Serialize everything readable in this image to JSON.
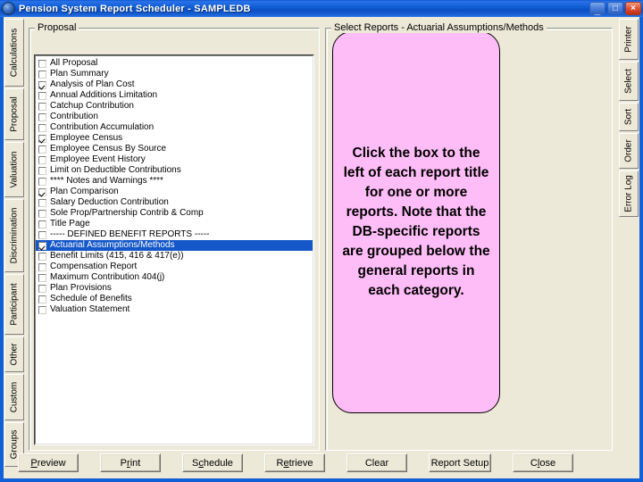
{
  "window": {
    "title": "Pension System Report Scheduler - SAMPLEDB",
    "app_icon": "globe-icon",
    "minimize_label": "_",
    "maximize_label": "□",
    "close_label": "×"
  },
  "left_tabs": [
    {
      "label": "Calculations"
    },
    {
      "label": "Proposal"
    },
    {
      "label": "Valuation"
    },
    {
      "label": "Discrimination"
    },
    {
      "label": "Participant"
    },
    {
      "label": "Other"
    },
    {
      "label": "Custom"
    },
    {
      "label": "Groups"
    }
  ],
  "right_tabs": [
    {
      "label": "Printer"
    },
    {
      "label": "Select"
    },
    {
      "label": "Sort"
    },
    {
      "label": "Order"
    },
    {
      "label": "Error Log"
    }
  ],
  "left_panel": {
    "group_title": "Proposal",
    "items": [
      {
        "label": "All Proposal",
        "checked": false,
        "selected": false
      },
      {
        "label": "Plan Summary",
        "checked": false,
        "selected": false
      },
      {
        "label": "Analysis of Plan Cost",
        "checked": true,
        "selected": false
      },
      {
        "label": "Annual Additions Limitation",
        "checked": false,
        "selected": false
      },
      {
        "label": "Catchup Contribution",
        "checked": false,
        "selected": false
      },
      {
        "label": "Contribution",
        "checked": false,
        "selected": false
      },
      {
        "label": "Contribution Accumulation",
        "checked": false,
        "selected": false
      },
      {
        "label": "Employee Census",
        "checked": true,
        "selected": false
      },
      {
        "label": "Employee Census By Source",
        "checked": false,
        "selected": false
      },
      {
        "label": "Employee Event History",
        "checked": false,
        "selected": false
      },
      {
        "label": "Limit on Deductible Contributions",
        "checked": false,
        "selected": false
      },
      {
        "label": "**** Notes and Warnings ****",
        "checked": false,
        "selected": false
      },
      {
        "label": "Plan Comparison",
        "checked": true,
        "selected": false
      },
      {
        "label": "Salary Deduction Contribution",
        "checked": false,
        "selected": false
      },
      {
        "label": "Sole Prop/Partnership Contrib & Comp",
        "checked": false,
        "selected": false
      },
      {
        "label": "Title Page",
        "checked": false,
        "selected": false
      },
      {
        "label": "----- DEFINED BENEFIT REPORTS -----",
        "checked": false,
        "selected": false
      },
      {
        "label": "Actuarial Assumptions/Methods",
        "checked": true,
        "selected": true
      },
      {
        "label": "Benefit Limits (415, 416 & 417(e))",
        "checked": false,
        "selected": false
      },
      {
        "label": "Compensation Report",
        "checked": false,
        "selected": false
      },
      {
        "label": "Maximum Contribution 404(j)",
        "checked": false,
        "selected": false
      },
      {
        "label": "Plan Provisions",
        "checked": false,
        "selected": false
      },
      {
        "label": "Schedule of Benefits",
        "checked": false,
        "selected": false
      },
      {
        "label": "Valuation Statement",
        "checked": false,
        "selected": false
      }
    ]
  },
  "right_panel": {
    "group_title": "Select Reports - Actuarial Assumptions/Methods",
    "callout_text": "Click the box to the left of each report title for one or more reports.  Note that the DB-specific reports are grouped below the general reports in each category."
  },
  "buttons": [
    {
      "label": "Preview",
      "accel": "P"
    },
    {
      "label": "Print",
      "accel": "r"
    },
    {
      "label": "Schedule",
      "accel": "c"
    },
    {
      "label": "Retrieve",
      "accel": "e"
    },
    {
      "label": "Clear",
      "accel": ""
    },
    {
      "label": "Report Setup",
      "accel": ""
    },
    {
      "label": "Close",
      "accel": "l"
    }
  ],
  "colors": {
    "titlebar_blue": "#1260d8",
    "face": "#ece9d8",
    "selection_blue": "#1457c8",
    "callout_pink": "#ffbdf7"
  }
}
